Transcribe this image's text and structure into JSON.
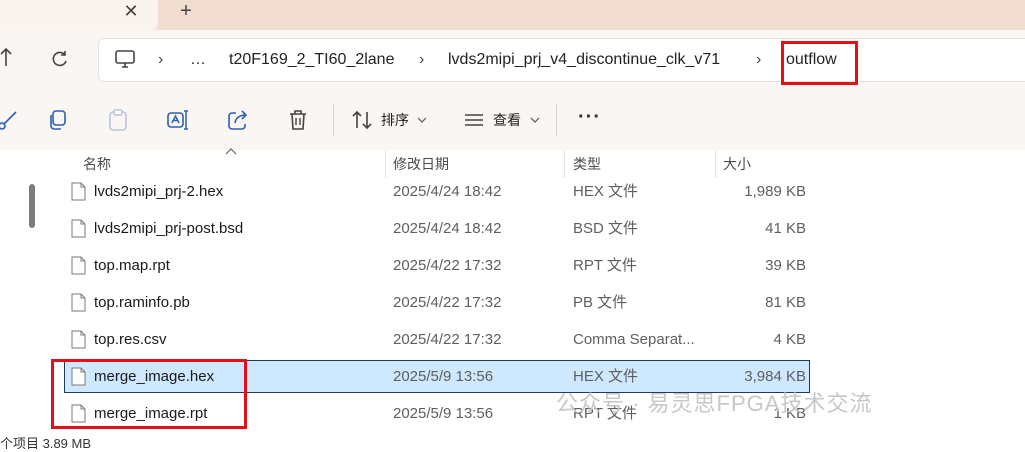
{
  "tabs": {
    "close_glyph": "✕",
    "new_tab_glyph": "+"
  },
  "breadcrumb": {
    "items": [
      "…",
      "t20F169_2_TI60_2lane",
      "lvds2mipi_prj_v4_discontinue_clk_v71",
      "outflow"
    ],
    "separator": "›"
  },
  "toolbar": {
    "sort_label": "排序",
    "view_label": "查看",
    "more_glyph": "···",
    "icons": [
      "cut-icon",
      "copy-icon",
      "paste-icon",
      "rename-icon",
      "share-icon",
      "delete-icon",
      "sort-icon",
      "view-icon"
    ]
  },
  "columns": {
    "name": "名称",
    "modified": "修改日期",
    "type": "类型",
    "size": "大小"
  },
  "files": [
    {
      "name": "lvds2mipi_prj-2.hex",
      "modified": "2025/4/24 18:42",
      "type": "HEX 文件",
      "size": "1,989 KB"
    },
    {
      "name": "lvds2mipi_prj-post.bsd",
      "modified": "2025/4/24 18:42",
      "type": "BSD 文件",
      "size": "41 KB"
    },
    {
      "name": "top.map.rpt",
      "modified": "2025/4/22 17:32",
      "type": "RPT 文件",
      "size": "39 KB"
    },
    {
      "name": "top.raminfo.pb",
      "modified": "2025/4/22 17:32",
      "type": "PB 文件",
      "size": "81 KB"
    },
    {
      "name": "top.res.csv",
      "modified": "2025/4/22 17:32",
      "type": "Comma Separat...",
      "size": "4 KB"
    },
    {
      "name": "merge_image.hex",
      "modified": "2025/5/9 13:56",
      "type": "HEX 文件",
      "size": "3,984 KB",
      "selected": true
    },
    {
      "name": "merge_image.rpt",
      "modified": "2025/5/9 13:56",
      "type": "RPT 文件",
      "size": "1 KB"
    }
  ],
  "status_bar": "个项目  3.89 MB",
  "watermark": "公众号 · 易灵思FPGA技术交流",
  "colors": {
    "highlight": "#e3101a",
    "selection": "#cde8ff",
    "accent": "#1e3b5a"
  }
}
